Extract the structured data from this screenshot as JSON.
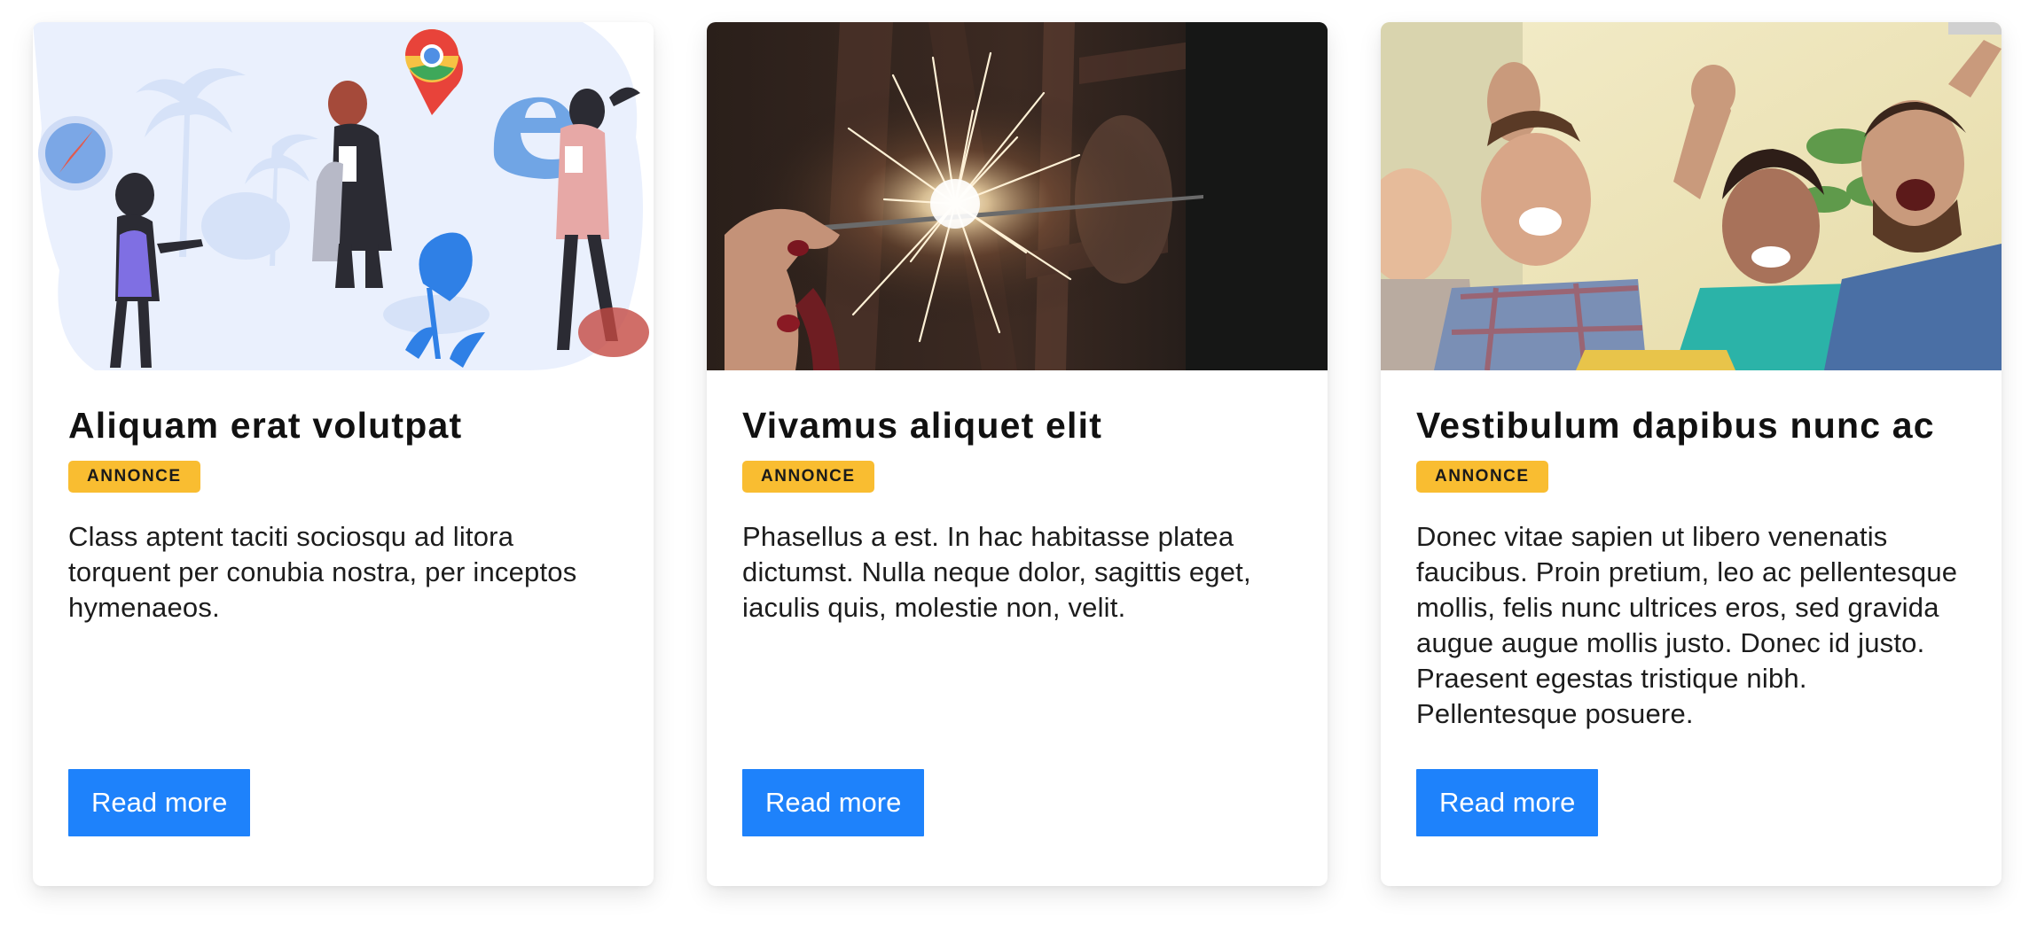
{
  "cards": [
    {
      "title": "Aliquam erat volutpat",
      "badge": "ANNONCE",
      "text": "Class aptent taciti sociosqu ad litora torquent per conubia nostra, per inceptos hymenaeos.",
      "button": "Read more",
      "image": "browser-illustration"
    },
    {
      "title": "Vivamus aliquet elit",
      "badge": "ANNONCE",
      "text": "Phasellus a est. In hac habitasse platea dictumst. Nulla neque dolor, sagittis eget, iaculis quis, molestie non, velit.",
      "button": "Read more",
      "image": "sparkler-photo"
    },
    {
      "title": "Vestibulum dapibus nunc ac",
      "badge": "ANNONCE",
      "text": "Donec vitae sapien ut libero venenatis faucibus. Proin pretium, leo ac pellentesque mollis, felis nunc ultrices eros, sed gravida augue augue mollis justo. Donec id justo. Praesent egestas tristique nibh. Pellentesque posuere.",
      "button": "Read more",
      "image": "celebrating-friends-photo"
    }
  ],
  "colors": {
    "badge": "#f9bd31",
    "button": "#1e82fb",
    "card_bg": "#ffffff"
  }
}
